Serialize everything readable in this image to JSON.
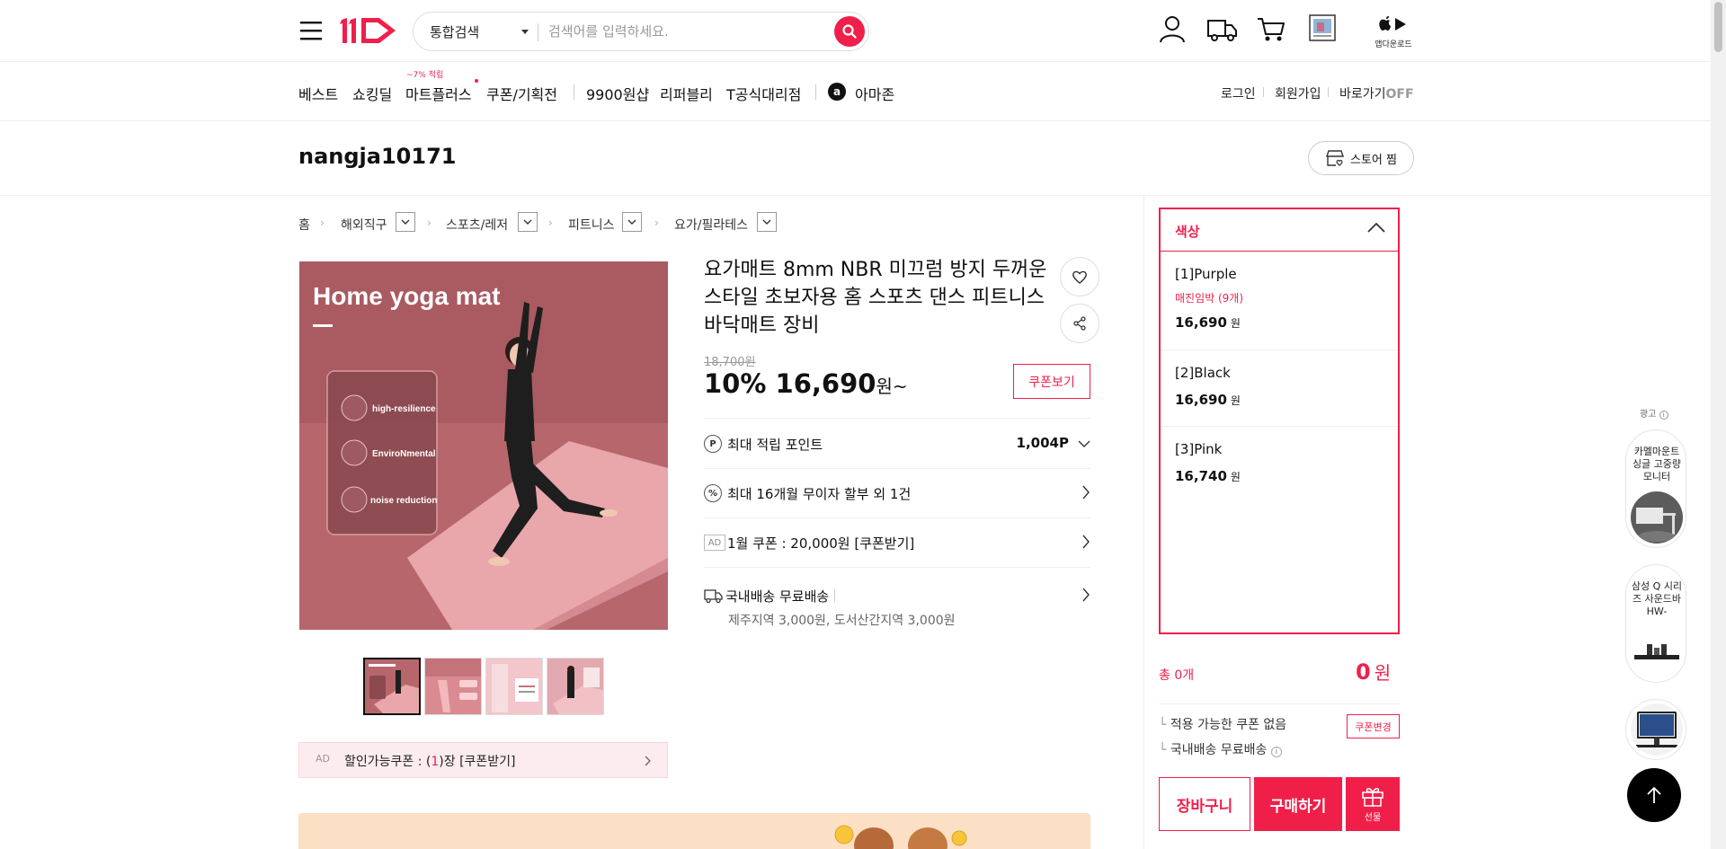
{
  "header": {
    "search": {
      "category": "통합검색",
      "placeholder": "검색어를 입력하세요."
    },
    "app_download_label": "앱다운로드"
  },
  "nav": {
    "items": [
      "베스트",
      "쇼킹딜",
      "마트플러스",
      "쿠폰/기획전",
      "9900원샵",
      "리퍼블리",
      "T공식대리점",
      "아마존"
    ],
    "badge": "~7% 적립",
    "amazon_letter": "a",
    "util": {
      "login": "로그인",
      "signup": "회원가입",
      "shortcut": "바로가기",
      "shortcut_state": "OFF"
    }
  },
  "store": {
    "name": "nangja10171",
    "fav_label": "스토어 찜"
  },
  "breadcrumb": [
    "홈",
    "해외직구",
    "스포츠/레저",
    "피트니스",
    "요가/필라테스"
  ],
  "product": {
    "image_texts": {
      "title": "Home yoga mat",
      "feature1": "high-resilience",
      "feature2": "EnviroNmental",
      "feature3": "noise reduction"
    },
    "title": "요가매트 8mm NBR 미끄럼 방지 두꺼운 스타일 초보자용 홈 스포츠 댄스 피트니스 바닥매트 장비",
    "original_price": "18,700원",
    "discount": "10%",
    "price": "16,690",
    "price_unit": "원~",
    "coupon_button": "쿠폰보기",
    "points_label": "최대 적립 포인트",
    "points_value": "1,004P",
    "points_icon": "P",
    "installment_label": "최대 16개월 무이자 할부 외 1건",
    "installment_icon": "%",
    "ad_coupon_label": "1월 쿠폰 : 20,000원 [쿠폰받기]",
    "ad_mark": "AD",
    "shipping_label": "국내배송 무료배송",
    "shipping_sub": "제주지역 3,000원, 도서산간지역 3,000원",
    "discount_coupon": {
      "ad": "AD",
      "prefix": "할인가능쿠폰 : (",
      "count": "1",
      "suffix": ")장 [쿠폰받기]"
    }
  },
  "options": {
    "header": "색상",
    "items": [
      {
        "name": "[1]Purple",
        "note": "매진임박 (9개)",
        "price": "16,690",
        "unit": "원"
      },
      {
        "name": "[2]Black",
        "price": "16,690",
        "unit": "원"
      },
      {
        "name": "[3]Pink",
        "price": "16,740",
        "unit": "원"
      }
    ]
  },
  "order": {
    "total_label": "총 0개",
    "total_value": "0",
    "total_unit": "원",
    "coupon_note": "적용 가능한 쿠폰 없음",
    "coupon_change": "쿠폰변경",
    "shipping_note": "국내배송 무료배송",
    "cart": "장바구니",
    "buy": "구매하기",
    "gift": "선물"
  },
  "ad_rail": {
    "label": "광고",
    "cards": [
      {
        "text": "카멜마운트 싱글 고중량 모니터"
      },
      {
        "text": "삼성 Q 시리즈 사운드바 HW-"
      },
      {
        "text": ""
      }
    ]
  },
  "colors": {
    "accent": "#f01f4a",
    "mat_pink": "#e9a6ab",
    "bg_mauve": "#b7676c"
  }
}
